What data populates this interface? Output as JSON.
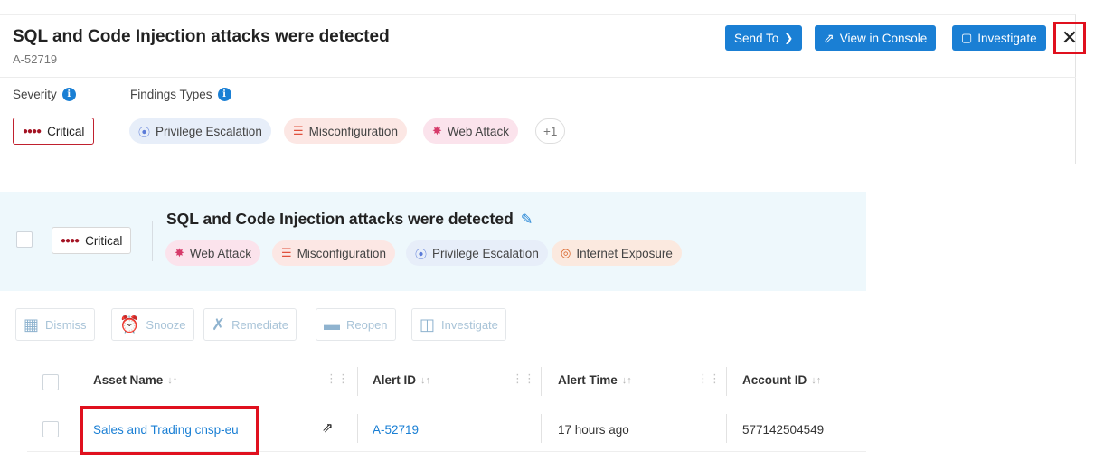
{
  "header": {
    "title": "SQL and Code Injection attacks were detected",
    "alert_id": "A-52719",
    "buttons": {
      "send_to": "Send To",
      "view_console": "View in Console",
      "investigate": "Investigate"
    },
    "close_glyph": "✕"
  },
  "summary": {
    "severity_label": "Severity",
    "findings_label": "Findings Types",
    "severity": "Critical",
    "findings": [
      {
        "label": "Privilege Escalation",
        "icon": "fingerprint-icon",
        "color": "#e7eef9"
      },
      {
        "label": "Misconfiguration",
        "icon": "sliders-icon",
        "color": "#fce7e4"
      },
      {
        "label": "Web Attack",
        "icon": "bug-icon",
        "color": "#fbe3ec"
      }
    ],
    "more": "+1"
  },
  "card": {
    "severity": "Critical",
    "title": "SQL and Code Injection attacks were detected",
    "findings": [
      {
        "label": "Web Attack",
        "icon": "bug-icon",
        "color": "#fbe3ec"
      },
      {
        "label": "Misconfiguration",
        "icon": "sliders-icon",
        "color": "#fce7e4"
      },
      {
        "label": "Privilege Escalation",
        "icon": "fingerprint-icon",
        "color": "#e7eef9"
      },
      {
        "label": "Internet Exposure",
        "icon": "globe-icon",
        "color": "#fbe9df"
      }
    ]
  },
  "actions": [
    "Dismiss",
    "Snooze",
    "Remediate",
    "Reopen",
    "Investigate"
  ],
  "table": {
    "columns": [
      "Asset Name",
      "Alert ID",
      "Alert Time",
      "Account ID"
    ],
    "rows": [
      {
        "asset_name": "Sales and Trading cnsp-eu",
        "alert_id": "A-52719",
        "alert_time": "17 hours ago",
        "account_id": "577142504549"
      }
    ]
  },
  "colors": {
    "accent": "#1a7fd4",
    "critical": "#a41424",
    "highlight": "#e0101e",
    "card_bg": "#eef8fc"
  }
}
